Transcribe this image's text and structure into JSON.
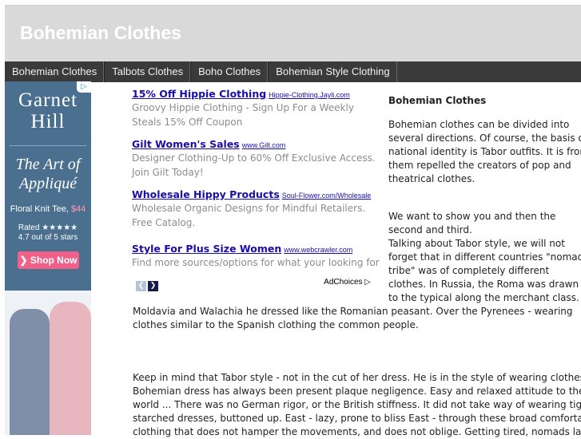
{
  "site": {
    "title": "Bohemian Clothes"
  },
  "nav": {
    "items": [
      "Bohemian Clothes",
      "Talbots Clothes",
      "Boho Clothes",
      "Bohemian Style Clothing"
    ]
  },
  "banner": {
    "brand_line1": "Garnet",
    "brand_line2": "Hill",
    "headline_line1": "The Art of",
    "headline_line2": "Appliqué",
    "product": "Floral Knit Tee,",
    "price": "$44",
    "rating_line1": "Rated ★★★★★",
    "rating_line2": "4.7 out of 5 stars",
    "cta": "❯ Shop Now",
    "adchoice_symbol": "▷"
  },
  "ads": [
    {
      "title": "15% Off Hippie Clothing",
      "url": "Hippie-Clothing.Jayli.com",
      "desc": [
        "Groovy Hippie Clothing - Sign Up For a Weekly",
        "Steals 15% Off Coupon"
      ]
    },
    {
      "title": "Gilt Women's Sales",
      "url": "www.Gilt.com",
      "desc": [
        "Designer Clothing-Up to 60% Off Exclusive Access.",
        "Join Gilt Today!"
      ]
    },
    {
      "title": "Wholesale Hippy Products",
      "url": "Soul-Flower.com/Wholesale",
      "desc": [
        "Wholesale Organic Designs for Mindful Retailers.",
        "Free Catalog."
      ]
    },
    {
      "title": "Style For Plus Size Women",
      "url": "www.webcrawler.com",
      "desc": [
        "Find more sources/options for what your looking for"
      ]
    }
  ],
  "ad_nav": {
    "prev": "❮",
    "next": "❯",
    "adchoices": "AdChoices ▷"
  },
  "article": {
    "heading": "Bohemian Clothes",
    "p1": [
      "Bohemian clothes can be divided into",
      "several directions. Of course, the basis of",
      "national identity is Tabor outfits. It is from",
      "them repelled the creators of pop and",
      "theatrical clothes."
    ],
    "p2": [
      "We want to show you and then the",
      "second and third."
    ],
    "p2b": [
      "Talking about Tabor style, we will not",
      "forget that in different countries \"nomadic",
      "tribe\" was of completely different",
      "clothes. In Russia, the Roma was drawn",
      "to the typical along the merchant class. In"
    ],
    "p2_cont": [
      "Moldavia and Walachia he dressed like the Romanian peasant. Over the Pyrenees - wearing",
      "clothes similar to the Spanish clothing the common people."
    ],
    "p3": [
      "Keep in mind that Tabor style - not in the cut of her dress. He is in the style of wearing clothes! In",
      "Bohemian dress has always been present plaque negligence. Easy and relaxed attitude to the",
      "world ... There was no German rigor, or the British stiffness. It did not take way of wearing tight",
      "starched dresses, buttoned up. East - lazy, prone to bliss East - through these broad comfortable",
      "clothing that does not hamper the movements, and does not oblige. Getting tired, nomads lay"
    ]
  }
}
